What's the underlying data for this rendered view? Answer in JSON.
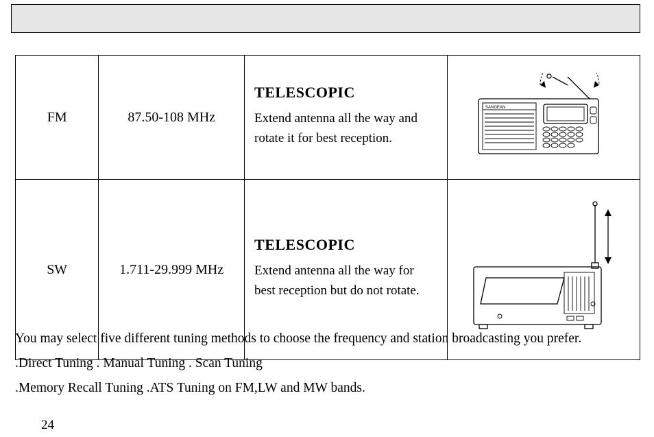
{
  "table": {
    "rows": [
      {
        "band": "FM",
        "freq": "87.50-108 MHz",
        "antenna_title": "TELESCOPIC",
        "antenna_body": "Extend antenna all the way and rotate it for best reception."
      },
      {
        "band": "SW",
        "freq": "1.711-29.999 MHz",
        "antenna_title": "TELESCOPIC",
        "antenna_body": "Extend antenna all the way for best reception but do not rotate."
      }
    ]
  },
  "paragraphs": {
    "intro": "You may select five different tuning methods to choose the frequency and station broadcasting you prefer.",
    "line2": ".Direct Tuning . Manual Tuning . Scan Tuning",
    "line3": ".Memory Recall Tuning .ATS Tuning on FM,LW and MW bands."
  },
  "page_number": "24",
  "illustrations": {
    "fm": "radio-front-rotating-antenna",
    "sw": "radio-back-vertical-antenna"
  },
  "brand_label": "SANGEAN"
}
